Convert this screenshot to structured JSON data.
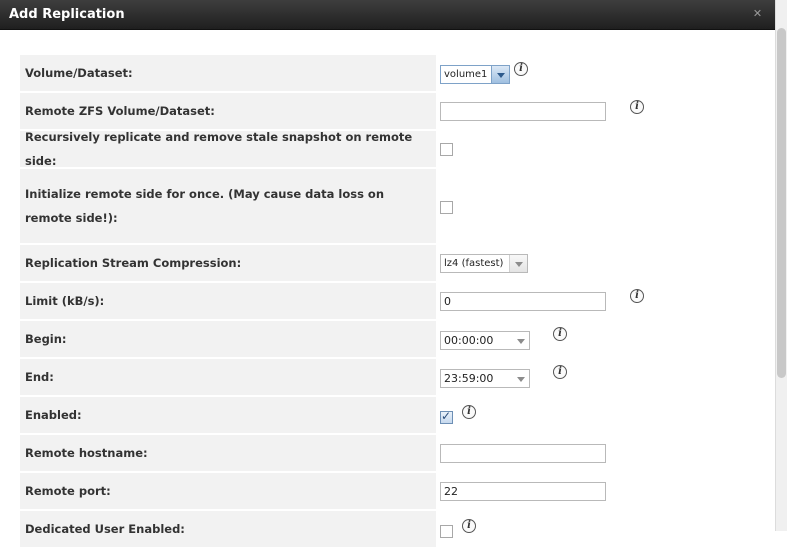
{
  "dialog": {
    "title": "Add Replication",
    "close_symbol": "✕"
  },
  "fields": {
    "volume_dataset": {
      "label": "Volume/Dataset:",
      "value": "volume1"
    },
    "remote_zfs": {
      "label": "Remote ZFS Volume/Dataset:",
      "value": ""
    },
    "recursive": {
      "label": "Recursively replicate and remove stale snapshot on remote side:",
      "checked": false
    },
    "initialize": {
      "label": "Initialize remote side for once. (May cause data loss on remote side!):",
      "checked": false
    },
    "compression": {
      "label": "Replication Stream Compression:",
      "value": "lz4 (fastest)"
    },
    "limit": {
      "label": "Limit (kB/s):",
      "value": "0"
    },
    "begin": {
      "label": "Begin:",
      "value": "00:00:00"
    },
    "end": {
      "label": "End:",
      "value": "23:59:00"
    },
    "enabled": {
      "label": "Enabled:",
      "checked": true
    },
    "remote_hostname": {
      "label": "Remote hostname:",
      "value": ""
    },
    "remote_port": {
      "label": "Remote port:",
      "value": "22"
    },
    "dedicated_user": {
      "label": "Dedicated User Enabled:",
      "checked": false
    }
  },
  "info_glyph": "i"
}
